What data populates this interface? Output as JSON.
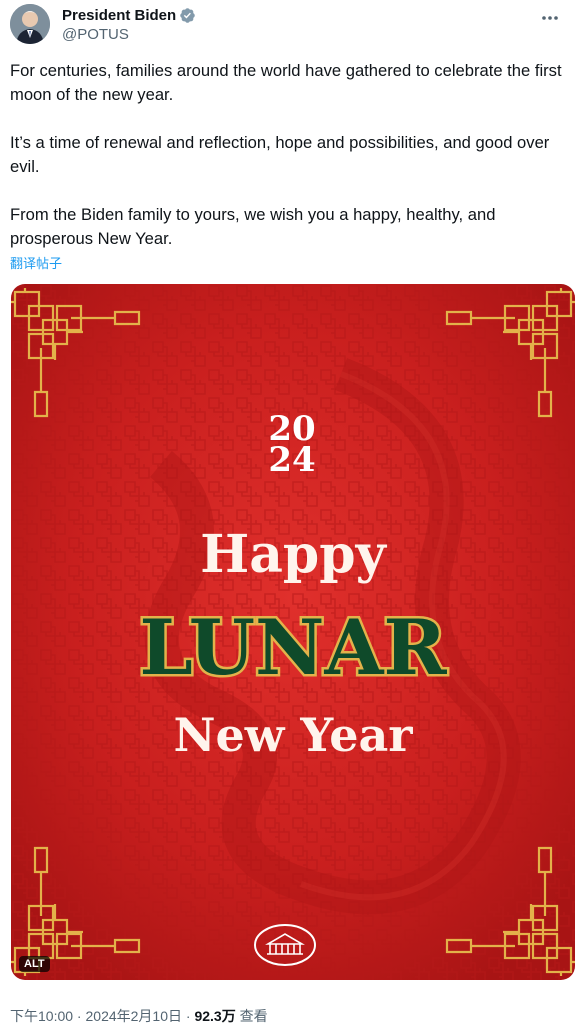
{
  "author": {
    "display_name": "President Biden",
    "handle": "@POTUS",
    "verified_icon": "verified-badge-icon"
  },
  "tweet": {
    "paragraphs": [
      "For centuries, families around the world have gathered to celebrate the first moon of the new year.",
      "It’s a time of renewal and reflection, hope and possibilities, and good over evil.",
      "From the Biden family to yours, we wish you a happy, healthy, and prosperous New Year."
    ],
    "translate_label": "翻译帖子"
  },
  "media": {
    "year_top": "20",
    "year_bottom": "24",
    "line1": "Happy",
    "line2": "LUNAR",
    "line3": "New Year",
    "alt_label": "ALT",
    "colors": {
      "background": "#c8201f",
      "gold": "#e3b24a",
      "green": "#0f4a2a"
    }
  },
  "meta": {
    "time": "下午10:00",
    "separator": " · ",
    "date": "2024年2月10日",
    "views": "92.3万",
    "views_label": "查看"
  }
}
